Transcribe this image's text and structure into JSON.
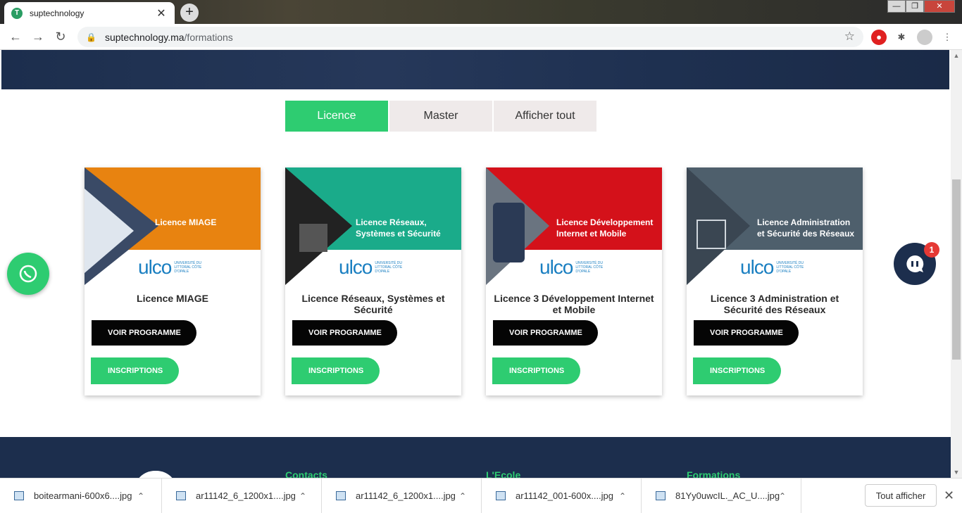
{
  "browser": {
    "tab_title": "suptechnology",
    "tab_close": "✕",
    "new_tab": "+",
    "url_host": "suptechnology.ma",
    "url_path": "/formations",
    "win_min": "—",
    "win_max": "❐",
    "win_close": "✕"
  },
  "filters": [
    "Licence",
    "Master",
    "Afficher tout"
  ],
  "cards": [
    {
      "banner": "Licence MIAGE",
      "title": "Licence MIAGE",
      "color": "#e88310",
      "bg": "#1f2a3c"
    },
    {
      "banner": "Licence Réseaux, Systèmes et Sécurité",
      "title": "Licence Réseaux, Systèmes et Sécurité",
      "color": "#1aab8a",
      "bg": "#0f5547"
    },
    {
      "banner": "Licence Développement Internet et Mobile",
      "title": "Licence 3 Développement Internet et Mobile",
      "color": "#d4111a",
      "bg": "#7a0a0a"
    },
    {
      "banner": "Licence Administration et Sécurité des Réseaux",
      "title": "Licence 3 Administration et Sécurité des Réseaux",
      "color": "#4e5f6c",
      "bg": "#2f3a43"
    }
  ],
  "buttons": {
    "program": "VOIR PROGRAMME",
    "register": "INSCRIPTIONS"
  },
  "ulco": {
    "word": "ulco",
    "sub": "UNIVERSITÉ DU LITTORAL CÔTE D'OPALE"
  },
  "chat": {
    "badge": "1"
  },
  "footer": {
    "contacts": "Contacts",
    "ecole": "L'Ecole",
    "formations": "Formations"
  },
  "downloads": {
    "items": [
      "boitearmani-600x6....jpg",
      "ar11142_6_1200x1....jpg",
      "ar11142_6_1200x1....jpg",
      "ar11142_001-600x....jpg",
      "81Yy0uwcIL._AC_U....jpg"
    ],
    "show_all": "Tout afficher",
    "close": "✕"
  },
  "colors": {
    "accent": "#2ecc71",
    "navy": "#1c2e4d"
  }
}
